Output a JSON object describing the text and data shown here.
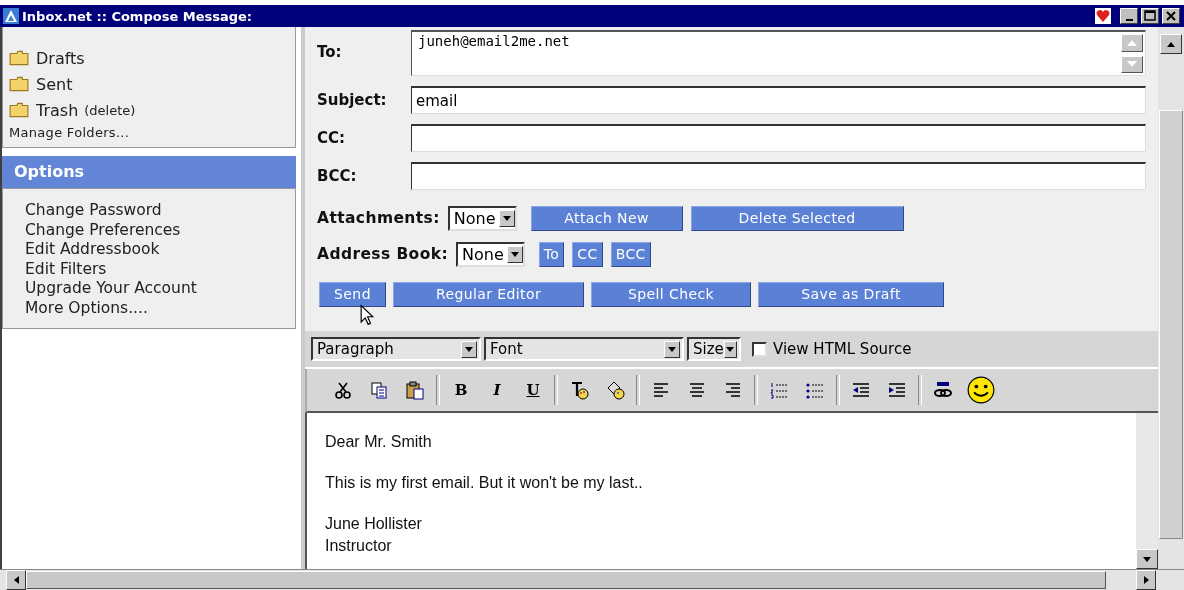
{
  "window": {
    "title": "Inbox.net :: Compose Message:"
  },
  "folders": [
    {
      "name": "Drafts"
    },
    {
      "name": "Sent"
    },
    {
      "name": "Trash",
      "action": "(delete)"
    }
  ],
  "manage_folders": "Manage Folders...",
  "options": {
    "title": "Options",
    "items": [
      "Change Password",
      "Change Preferences",
      "Edit Addressbook",
      "Edit Filters",
      "Upgrade Your Account",
      "More Options...."
    ]
  },
  "fields": [
    {
      "label": "To:",
      "kind": "textarea",
      "value": "juneh@email2me.net"
    },
    {
      "label": "Subject:",
      "kind": "input",
      "value": "email"
    },
    {
      "label": "CC:",
      "kind": "input"
    },
    {
      "label": "BCC:",
      "kind": "input"
    }
  ],
  "attachments": {
    "label": "Attachments:",
    "select": "None",
    "buttons": [
      "Attach New",
      "Delete Selected"
    ]
  },
  "address_book": {
    "label": "Address Book:",
    "select": "None",
    "buttons": [
      "To",
      "CC",
      "BCC"
    ]
  },
  "actions": [
    "Send",
    "Regular Editor",
    "Spell Check",
    "Save as Draft"
  ],
  "format_bar": {
    "selects": [
      "Paragraph",
      "Font",
      "Size"
    ],
    "view_html": {
      "label": "View HTML Source",
      "checked": false
    }
  },
  "style_buttons": [
    "B",
    "I",
    "U"
  ],
  "body": [
    [
      "Dear Mr. Smith"
    ],
    [
      "This is my first email. But it won't be my last.."
    ],
    [
      "June Hollister",
      "Instructor"
    ]
  ]
}
